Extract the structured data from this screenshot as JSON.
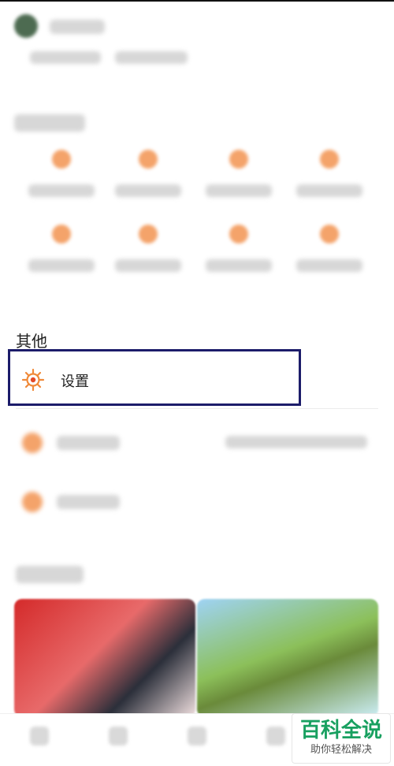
{
  "sections": {
    "other_title": "其他"
  },
  "settings_item": {
    "label": "设置",
    "icon": "settings-gear-icon"
  },
  "watermark": {
    "title": "百科全说",
    "subtitle": "助你轻松解决"
  },
  "colors": {
    "accent_orange": "#F08A3A",
    "highlight_border": "#1C1C6A",
    "watermark_green": "#18A060"
  }
}
